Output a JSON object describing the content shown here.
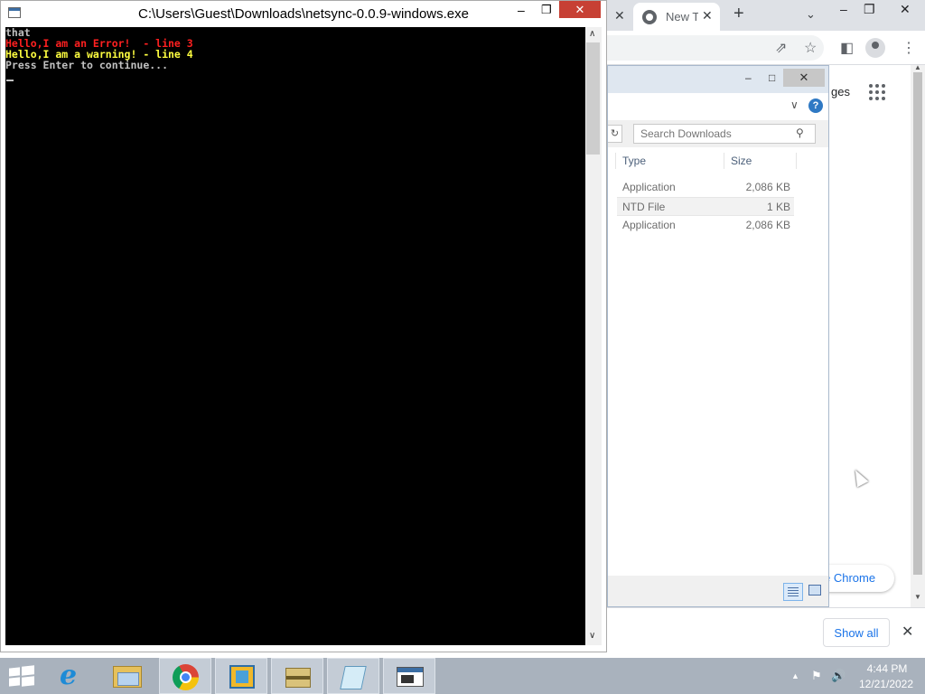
{
  "console": {
    "title": "C:\\Users\\Guest\\Downloads\\netsync-0.0.9-windows.exe",
    "lines": [
      {
        "text": "that",
        "color": "#c0c0c0"
      },
      {
        "text": "Hello,I am an Error!  - line 3",
        "color": "#ff2020"
      },
      {
        "text": "Hello,I am a warning! - line 4",
        "color": "#ffff40"
      },
      {
        "text": "Press Enter to continue...",
        "color": "#c0c0c0"
      }
    ],
    "controls": {
      "minimize": "–",
      "restore": "❐",
      "close": "✕"
    }
  },
  "chrome": {
    "tab_title": "New Tab",
    "tab_close": "✕",
    "prev_tab_close": "✕",
    "new_tab": "+",
    "tab_dropdown": "⌄",
    "window_controls": {
      "minimize": "–",
      "restore": "❐",
      "close": "✕"
    },
    "partial_link_text": "ges",
    "customize_button": "e Chrome",
    "show_all_button": "Show all",
    "download_bar_close": "✕"
  },
  "explorer": {
    "window_controls": {
      "minimize": "–",
      "maximize": "□",
      "close": "✕"
    },
    "help": "?",
    "search_placeholder": "Search Downloads",
    "columns": {
      "type": "Type",
      "size": "Size"
    },
    "files": [
      {
        "type": "Application",
        "size": "2,086 KB",
        "selected": false
      },
      {
        "type": "NTD File",
        "size": "1 KB",
        "selected": true
      },
      {
        "type": "Application",
        "size": "2,086 KB",
        "selected": false
      }
    ]
  },
  "taskbar": {
    "apps": [
      "start-icon",
      "internet-explorer-icon",
      "file-explorer-icon",
      "chrome-icon",
      "virtualbox-icon",
      "archive-icon",
      "notepad-icon",
      "console-icon"
    ],
    "active_app": "console-icon",
    "tray": {
      "chevron": "▲",
      "flag": "⚑",
      "volume": "🔊"
    },
    "time": "4:44 PM",
    "date": "12/21/2022"
  },
  "colors": {
    "console_bg": "#000000",
    "taskbar_bg": "#a9b2bd",
    "close_red": "#c74034",
    "chrome_blue": "#1a73e8"
  }
}
